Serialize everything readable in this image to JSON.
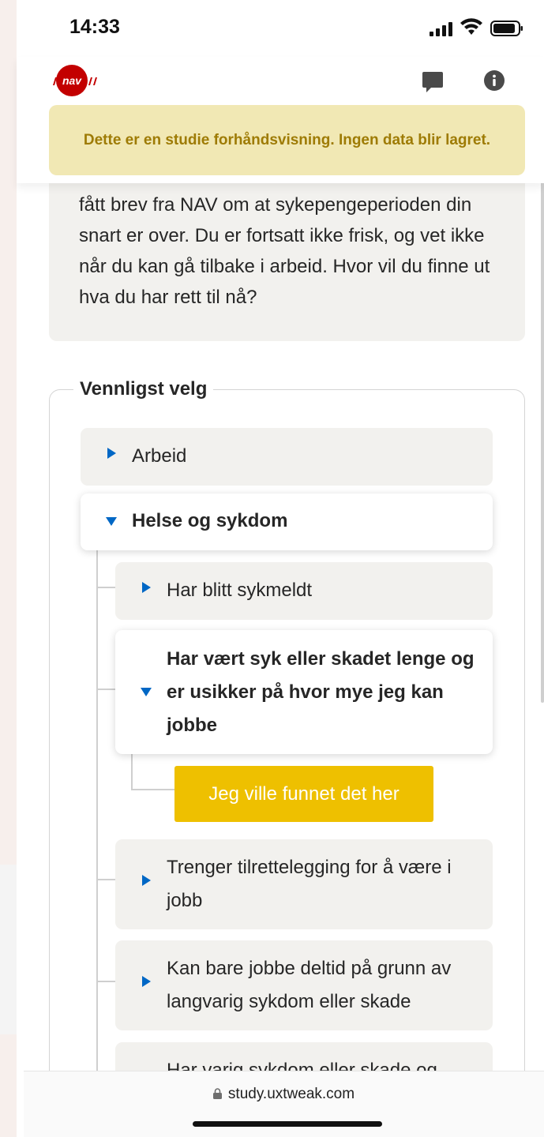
{
  "status_bar": {
    "time": "14:33"
  },
  "header": {
    "logo": "nav",
    "chat_icon": "chat-bubble-icon",
    "info_icon": "info-icon"
  },
  "banner": {
    "text": "Dette er en studie forhåndsvisning. Ingen data blir lagret."
  },
  "intro": {
    "text": "fått brev fra NAV om at sykepengeperioden din snart er over. Du er fortsatt ikke frisk, og vet ikke når du kan gå tilbake i arbeid. Hvor vil du finne ut hva du har rett til nå?"
  },
  "choice": {
    "legend": "Vennligst velg",
    "items": [
      {
        "label": "Arbeid",
        "expanded": false
      },
      {
        "label": "Helse og sykdom",
        "expanded": true
      },
      {
        "label": "Har blitt sykmeldt",
        "expanded": false
      },
      {
        "label": "Har vært syk eller skadet lenge og er usikker på hvor mye jeg kan jobbe",
        "expanded": true
      },
      {
        "label": "Trenger tilrettelegging for å være i jobb",
        "expanded": false
      },
      {
        "label": "Kan bare jobbe deltid på grunn av langvarig sykdom eller skade",
        "expanded": false
      },
      {
        "label": "Har varig sykdom eller skade og",
        "expanded": false
      }
    ],
    "button_label": "Jeg ville funnet det her"
  },
  "browser": {
    "url": "study.uxtweak.com"
  },
  "colors": {
    "accent_blue": "#0067c5",
    "button_yellow": "#eec000",
    "nav_red": "#c30000",
    "banner_bg": "#f1e8b4",
    "banner_text": "#9e7b05"
  }
}
